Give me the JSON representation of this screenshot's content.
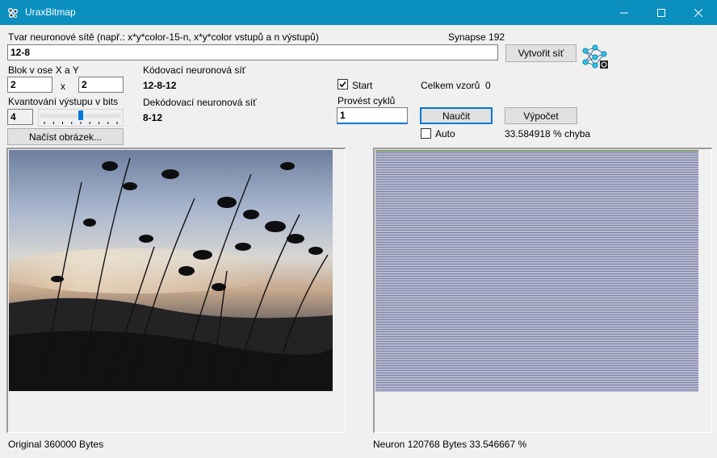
{
  "window": {
    "title": "UraxBitmap",
    "minimize_icon": "minimize-icon",
    "maximize_icon": "maximize-icon",
    "close_icon": "close-icon"
  },
  "network": {
    "shape_label": "Tvar neuronové sítě (např.: x*y*color-15-n, x*y*color vstupů a n výstupů)",
    "synapse_label": "Synapse 192",
    "shape_value": "12-8",
    "create_button": "Vytvořit síť",
    "network_icon": "neural-network-icon"
  },
  "block": {
    "label": "Blok v ose X a Y",
    "x_value": "2",
    "separator": "x",
    "y_value": "2"
  },
  "quantization": {
    "label": "Kvantování výstupu v bits",
    "value": "4",
    "slider_level": 4,
    "slider_max": 8
  },
  "load_button": "Načíst obrázek...",
  "encoding": {
    "coding_label": "Kódovací neuronová síť",
    "coding_value": "12-8-12",
    "decoding_label": "Dekódovací neuronová síť",
    "decoding_value": "8-12"
  },
  "controls": {
    "start_label": "Start",
    "start_checked": true,
    "cycles_label": "Provést cyklů",
    "cycles_value": "1",
    "total_label": "Celkem vzorů",
    "total_value": "0",
    "learn_button": "Naučit",
    "compute_button": "Výpočet",
    "auto_label": "Auto",
    "auto_checked": false,
    "error_text": "33.584918 % chyba"
  },
  "status": {
    "original_text": "Original  360000 Bytes",
    "neuron_text": "Neuron   120768 Bytes   33.546667 %"
  },
  "colors": {
    "titlebar": "#0a8fbf",
    "focus_blue": "#0078d7",
    "neuron_stripe_a": "#7f7fa8",
    "neuron_stripe_b": "#b5b9ce"
  }
}
